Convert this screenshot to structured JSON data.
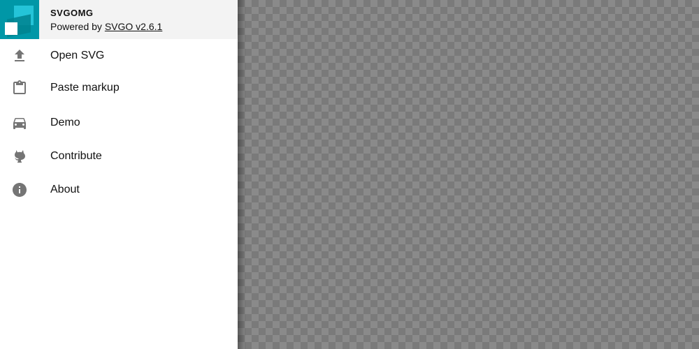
{
  "app": {
    "title": "SVGOMG",
    "subtitle_prefix": "Powered by ",
    "subtitle_link": "SVGO v2.6.1"
  },
  "menu": {
    "items": [
      {
        "label": "Open SVG",
        "icon": "upload-icon"
      },
      {
        "label": "Paste markup",
        "icon": "clipboard-icon"
      },
      {
        "label": "Demo",
        "icon": "car-icon"
      },
      {
        "label": "Contribute",
        "icon": "github-icon"
      },
      {
        "label": "About",
        "icon": "info-icon"
      }
    ]
  },
  "colors": {
    "accent": "#0097a7",
    "header_bg": "#f3f3f3",
    "icon": "#757575",
    "canvas_dark": "#7a7a7a",
    "canvas_light": "#8a8a8a"
  }
}
